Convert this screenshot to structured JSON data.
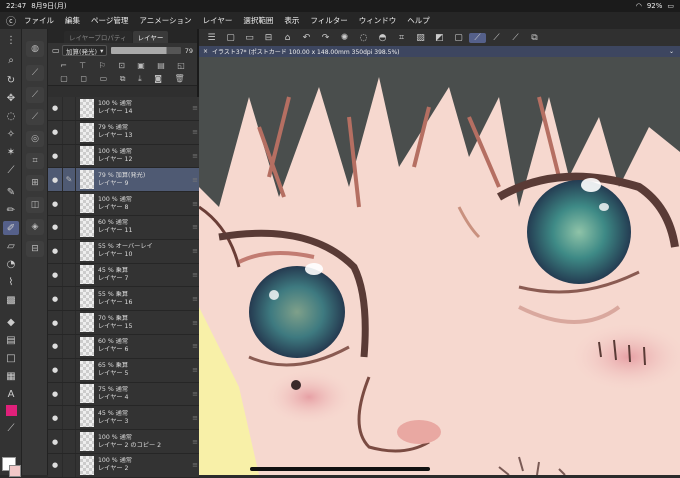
{
  "status": {
    "time": "22:47",
    "date": "8月9日(月)",
    "battery": "92%"
  },
  "menu": [
    "ファイル",
    "編集",
    "ページ管理",
    "アニメーション",
    "レイヤー",
    "選択範囲",
    "表示",
    "フィルター",
    "ウィンドウ",
    "ヘルプ"
  ],
  "layer_panel": {
    "tabs": [
      "レイヤープロパティ",
      "レイヤー"
    ],
    "blend_mode": "加算(発光)",
    "opacity": "79"
  },
  "layers": [
    {
      "mode": "100 % 通常",
      "name": "レイヤー 14"
    },
    {
      "mode": "79 % 通常",
      "name": "レイヤー 13"
    },
    {
      "mode": "100 % 通常",
      "name": "レイヤー 12"
    },
    {
      "mode": "79 % 加算(発光)",
      "name": "レイヤー 9",
      "selected": true
    },
    {
      "mode": "100 % 通常",
      "name": "レイヤー 8"
    },
    {
      "mode": "60 % 通常",
      "name": "レイヤー 11"
    },
    {
      "mode": "55 % オーバーレイ",
      "name": "レイヤー 10"
    },
    {
      "mode": "45 % 乗算",
      "name": "レイヤー 7"
    },
    {
      "mode": "55 % 乗算",
      "name": "レイヤー 16"
    },
    {
      "mode": "70 % 乗算",
      "name": "レイヤー 15"
    },
    {
      "mode": "60 % 通常",
      "name": "レイヤー 6"
    },
    {
      "mode": "65 % 乗算",
      "name": "レイヤー 5"
    },
    {
      "mode": "75 % 通常",
      "name": "レイヤー 4"
    },
    {
      "mode": "45 % 通常",
      "name": "レイヤー 3"
    },
    {
      "mode": "100 % 通常",
      "name": "レイヤー 2 のコピー 2"
    },
    {
      "mode": "100 % 通常",
      "name": "レイヤー 2"
    }
  ],
  "document_tab": "イラスト37* (ポストカード 100.00 x 148.00mm 350dpi 398.5%)",
  "colors": {
    "accent": "#55608a",
    "selected_row": "#4f5a73",
    "main_color": "#ffffff",
    "sub_color": "#f2c8c8",
    "swatch_pink": "#e0207a"
  }
}
